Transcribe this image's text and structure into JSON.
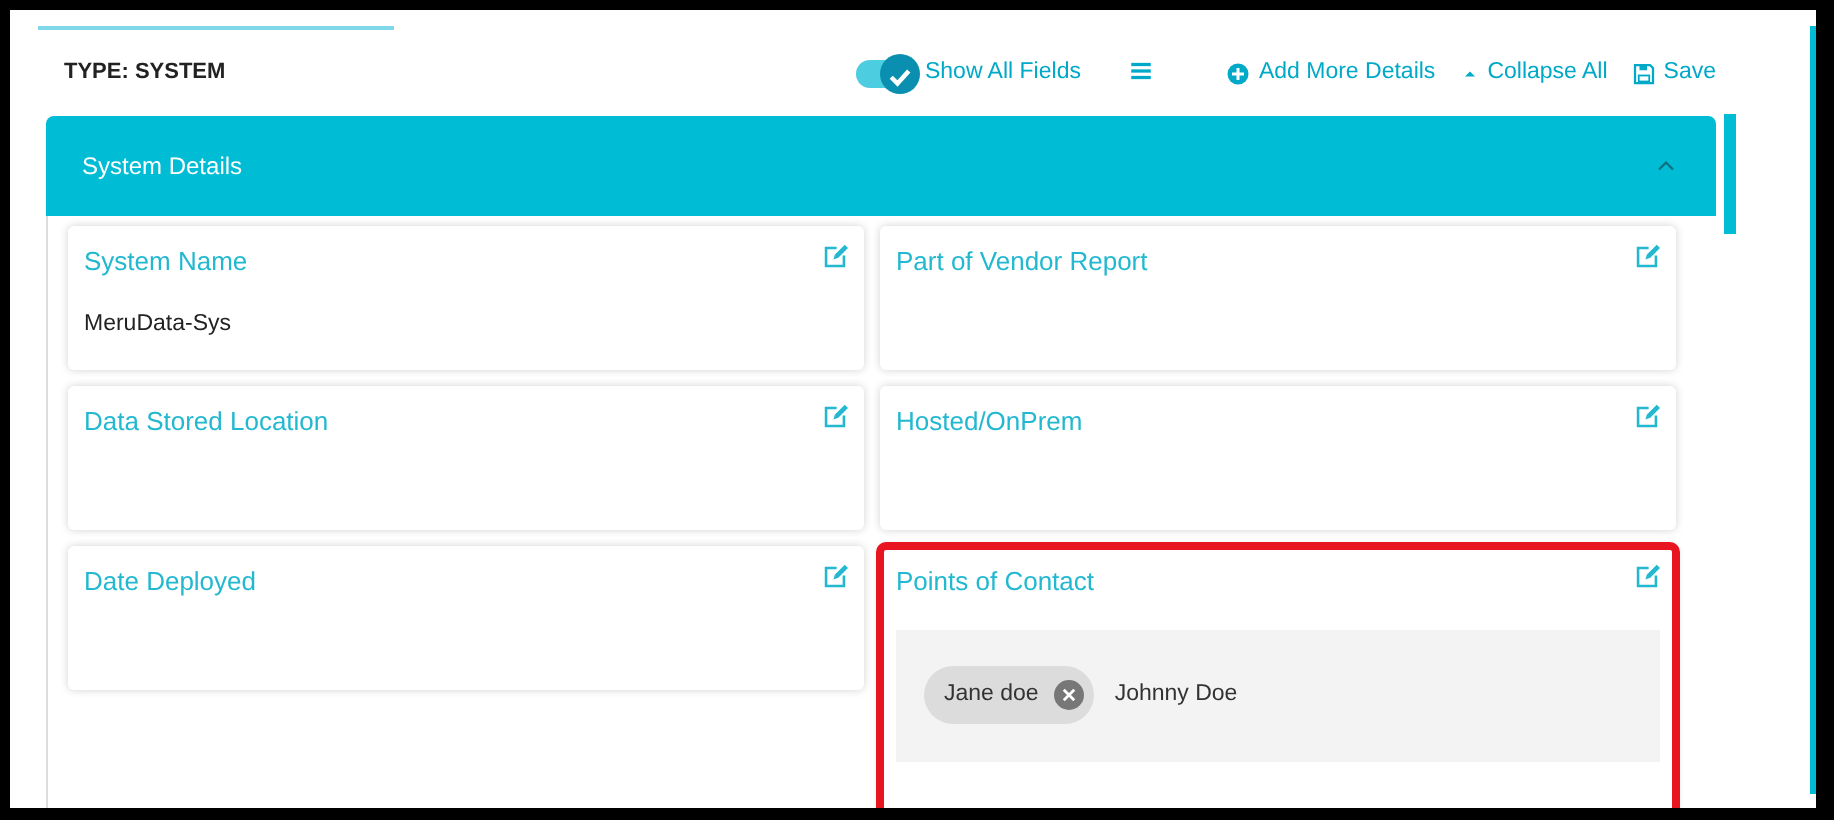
{
  "header": {
    "title": "TYPE: SYSTEM"
  },
  "toolbar": {
    "toggle": {
      "label": "Show All Fields",
      "on": true
    },
    "actions": [
      {
        "kind": "menu"
      },
      {
        "kind": "add",
        "label": "Add More Details"
      },
      {
        "kind": "collapse",
        "label": "Collapse All"
      },
      {
        "kind": "save",
        "label": "Save"
      }
    ]
  },
  "panel": {
    "title": "System Details",
    "expanded": true,
    "fields": [
      {
        "kind": "text",
        "label": "System Name",
        "value": "MeruData-Sys",
        "highlighted": false
      },
      {
        "kind": "text",
        "label": "Part of Vendor Report",
        "highlighted": false
      },
      {
        "kind": "text",
        "label": "Data Stored Location",
        "highlighted": false
      },
      {
        "kind": "text",
        "label": "Hosted/OnPrem",
        "highlighted": false
      },
      {
        "kind": "text",
        "label": "Date Deployed",
        "highlighted": false
      },
      {
        "kind": "tags",
        "label": "Points of Contact",
        "tags": [
          "Jane doe"
        ],
        "input_value": "Johnny Doe",
        "highlighted": true
      }
    ]
  }
}
